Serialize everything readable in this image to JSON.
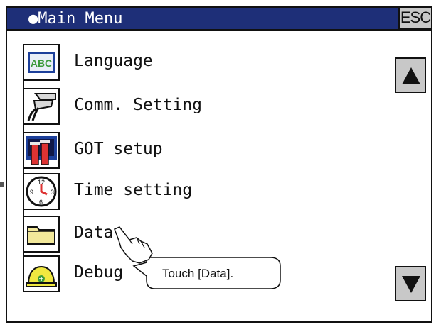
{
  "window": {
    "title": "●Main Menu",
    "esc_label": "ESC"
  },
  "menu": {
    "items": [
      {
        "label": "Language",
        "icon": "language-abc-icon"
      },
      {
        "label": "Comm. Setting",
        "icon": "connector-cable-icon"
      },
      {
        "label": "GOT setup",
        "icon": "monitor-tools-icon"
      },
      {
        "label": "Time setting",
        "icon": "clock-icon"
      },
      {
        "label": "Data",
        "icon": "folder-icon"
      },
      {
        "label": "Debug",
        "icon": "helmet-icon"
      }
    ]
  },
  "scroll": {
    "up_icon": "triangle-up-icon",
    "down_icon": "triangle-down-icon"
  },
  "callout": {
    "text": "Touch [Data].",
    "icon": "pointing-hand-icon"
  },
  "colors": {
    "titlebar": "#1e2f78",
    "button_gray": "#c8c8c8",
    "icon_blue": "#1c3f9a",
    "folder_yellow": "#f2e89a",
    "helmet_yellow": "#f0e840"
  }
}
